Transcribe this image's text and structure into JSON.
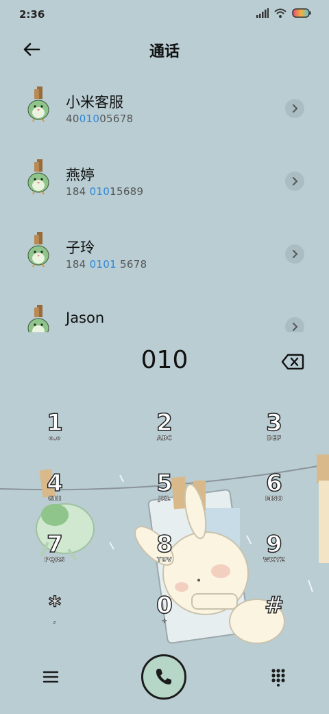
{
  "status": {
    "time": "2:36"
  },
  "header": {
    "title": "通话"
  },
  "contacts": [
    {
      "name": "小米客服",
      "num_pre": "40",
      "num_hl": "010",
      "num_post": "05678"
    },
    {
      "name": "燕婷",
      "num_pre": "184 ",
      "num_hl": "010",
      "num_post": "15689"
    },
    {
      "name": "子玲",
      "num_pre": "184 ",
      "num_hl": "0101",
      "num_post": " 5678"
    },
    {
      "name": "Jason",
      "num_pre": "",
      "num_hl": "",
      "num_post": ""
    }
  ],
  "dialer": {
    "input": "010"
  },
  "keys": [
    {
      "digit": "1",
      "letters": "o.o"
    },
    {
      "digit": "2",
      "letters": "ABC"
    },
    {
      "digit": "3",
      "letters": "DEF"
    },
    {
      "digit": "4",
      "letters": "GHI"
    },
    {
      "digit": "5",
      "letters": "JKL"
    },
    {
      "digit": "6",
      "letters": "MNO"
    },
    {
      "digit": "7",
      "letters": "PQRS"
    },
    {
      "digit": "8",
      "letters": "TUV"
    },
    {
      "digit": "9",
      "letters": "WXYZ"
    },
    {
      "digit": "*",
      "letters": ","
    },
    {
      "digit": "0",
      "letters": "+"
    },
    {
      "digit": "#",
      "letters": ""
    }
  ],
  "icons": {
    "back": "arrow-left-icon",
    "chevron": "chevron-right-icon",
    "backspace": "backspace-icon",
    "menu": "menu-icon",
    "call": "phone-icon",
    "keypad": "dialpad-icon"
  },
  "colors": {
    "background": "#b9cdd3",
    "highlight": "#2f88d8",
    "call_button": "#b6d7c8"
  }
}
